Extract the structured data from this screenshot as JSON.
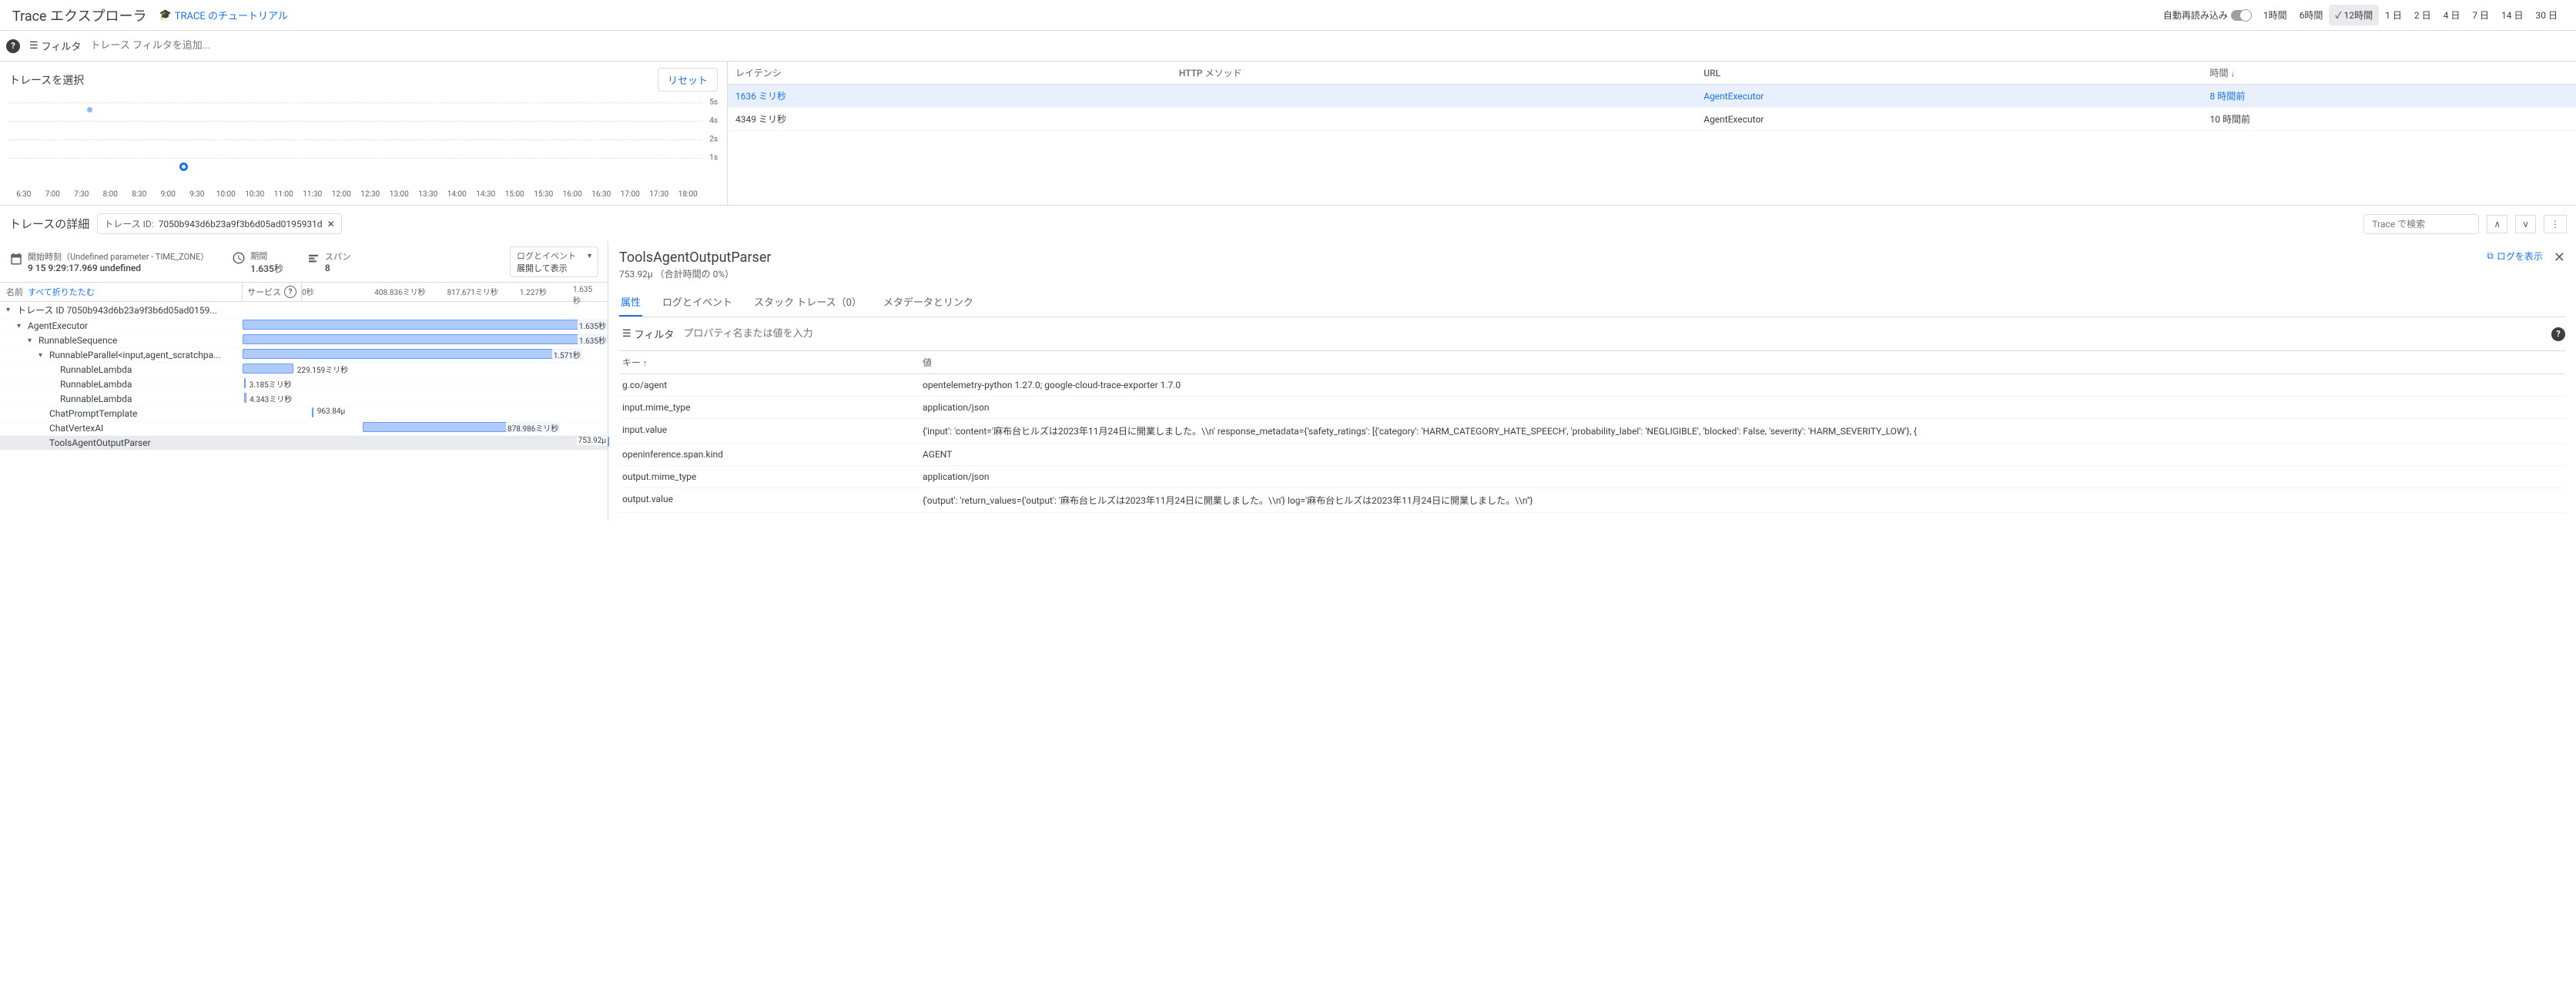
{
  "header": {
    "title": "Trace エクスプローラ",
    "tutorialLink": "TRACE のチュートリアル",
    "autoReload": "自動再読み込み",
    "timeRanges": [
      "1時間",
      "6時間",
      "12時間",
      "1 日",
      "2 日",
      "4 日",
      "7 日",
      "14 日",
      "30 日"
    ],
    "activeRange": "12時間"
  },
  "filter": {
    "label": "フィルタ",
    "placeholder": "トレース フィルタを追加..."
  },
  "selectTrace": {
    "title": "トレースを選択",
    "reset": "リセット"
  },
  "xTicks": [
    "6:30",
    "7:00",
    "7:30",
    "8:00",
    "8:30",
    "9:00",
    "9:30",
    "10:00",
    "10:30",
    "11:00",
    "11:30",
    "12:00",
    "12:30",
    "13:00",
    "13:30",
    "14:00",
    "14:30",
    "15:00",
    "15:30",
    "16:00",
    "16:30",
    "17:00",
    "17:30",
    "18:00"
  ],
  "yTicks": [
    "5s",
    "4s",
    "2s",
    "1s"
  ],
  "traceTable": {
    "cols": {
      "latency": "レイテンシ",
      "method": "HTTP メソッド",
      "url": "URL",
      "time": "時間"
    },
    "rows": [
      {
        "latency": "1636 ミリ秒",
        "method": "",
        "url": "AgentExecutor",
        "time": "8 時間前",
        "selected": true
      },
      {
        "latency": "4349 ミリ秒",
        "method": "",
        "url": "AgentExecutor",
        "time": "10 時間前"
      }
    ]
  },
  "detail": {
    "title": "トレースの詳細",
    "idLabel": "トレース ID:",
    "id": "7050b943d6b23a9f3b6d05ad0195931d",
    "searchPlaceholder": "Trace で検索",
    "start": {
      "label": "開始時刻（Undefined parameter - TIME_ZONE）",
      "value": "9 15 9:29:17.969 undefined"
    },
    "duration": {
      "label": "期間",
      "value": "1.635秒"
    },
    "span": {
      "label": "スパン",
      "value": "8"
    },
    "logEvent": {
      "label": "ログとイベント",
      "value": "展開して表示"
    },
    "nameCol": "名前",
    "collapse": "すべて折りたたむ",
    "serviceCol": "サービス",
    "timeMarks": [
      "0秒",
      "408.836ミリ秒",
      "817.671ミリ秒",
      "1.227秒",
      "1.635秒"
    ]
  },
  "spans": [
    {
      "indent": 0,
      "toggle": "▾",
      "name": "トレース ID 7050b943d6b23a9f3b6d05ad0159...",
      "left": 0,
      "width": 100,
      "dur": "",
      "noBar": true
    },
    {
      "indent": 1,
      "toggle": "▾",
      "name": "AgentExecutor",
      "left": 0,
      "width": 100,
      "dur": "1.635秒"
    },
    {
      "indent": 2,
      "toggle": "▾",
      "name": "RunnableSequence",
      "left": 0,
      "width": 100,
      "dur": "1.635秒"
    },
    {
      "indent": 3,
      "toggle": "▾",
      "name": "RunnableParallel<input,agent_scratchpa...",
      "left": 0,
      "width": 93,
      "dur": "1.571秒"
    },
    {
      "indent": 4,
      "toggle": "",
      "name": "RunnableLambda",
      "left": 0,
      "width": 14,
      "dur": "229.159ミリ秒",
      "lblOut": true
    },
    {
      "indent": 4,
      "toggle": "",
      "name": "RunnableLambda",
      "left": 0.4,
      "width": 0.5,
      "dur": "3.185ミリ秒",
      "lblOut": true
    },
    {
      "indent": 4,
      "toggle": "",
      "name": "RunnableLambda",
      "left": 0.4,
      "width": 0.6,
      "dur": "4.343ミリ秒",
      "lblOut": true
    },
    {
      "indent": 3,
      "toggle": "",
      "name": "ChatPromptTemplate",
      "left": 19,
      "width": 0.5,
      "dur": "963.84µ",
      "lblOut": true
    },
    {
      "indent": 3,
      "toggle": "",
      "name": "ChatVertexAI",
      "left": 33,
      "width": 54,
      "dur": "878.986ミリ秒"
    },
    {
      "indent": 3,
      "toggle": "",
      "name": "ToolsAgentOutputParser",
      "left": 100,
      "width": 0.2,
      "dur": "753.92µ",
      "lblOut": true,
      "lblLeft": true,
      "selected": true
    }
  ],
  "right": {
    "title": "ToolsAgentOutputParser",
    "sub": "753.92µ （合計時間の 0%）",
    "showLog": "ログを表示",
    "tabs": [
      "属性",
      "ログとイベント",
      "スタック トレース（0）",
      "メタデータとリンク"
    ],
    "filter": {
      "label": "フィルタ",
      "placeholder": "プロパティ名または値を入力"
    },
    "cols": {
      "key": "キー",
      "value": "値"
    },
    "rows": [
      {
        "k": "g.co/agent",
        "v": "opentelemetry-python 1.27.0; google-cloud-trace-exporter 1.7.0"
      },
      {
        "k": "input.mime_type",
        "v": "application/json"
      },
      {
        "k": "input.value",
        "v": "{'input': 'content='麻布台ヒルズは2023年11月24日に開業しました。\\\\n' response_metadata={'safety_ratings': [{'category': 'HARM_CATEGORY_HATE_SPEECH', 'probability_label': 'NEGLIGIBLE', 'blocked': False, 'severity': 'HARM_SEVERITY_LOW'}, {"
      },
      {
        "k": "openinference.span.kind",
        "v": "AGENT"
      },
      {
        "k": "output.mime_type",
        "v": "application/json"
      },
      {
        "k": "output.value",
        "v": "{'output': 'return_values={'output': '麻布台ヒルズは2023年11月24日に開業しました。\\\\n'} log='麻布台ヒルズは2023年11月24日に開業しました。\\\\n''}"
      }
    ]
  }
}
